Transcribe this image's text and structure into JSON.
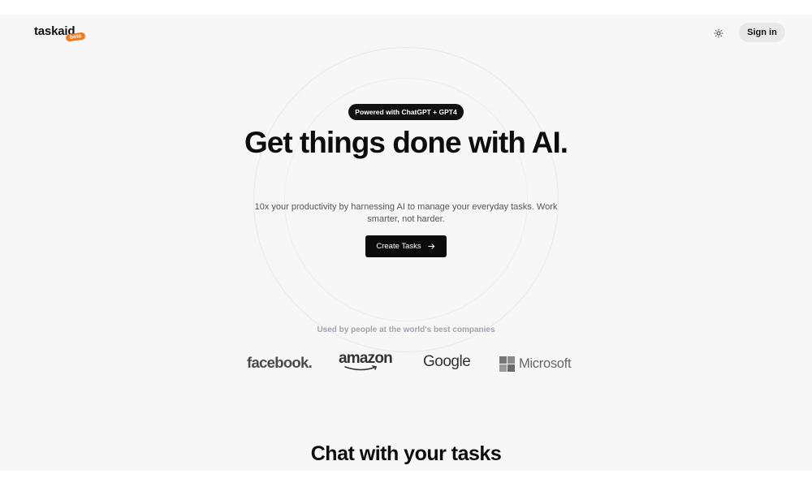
{
  "nav": {
    "logo": "taskaid",
    "beta_badge": "beta",
    "theme_icon": "sun-icon",
    "signin_label": "Sign in"
  },
  "hero": {
    "pill": "Powered with ChatGPT + GPT4",
    "title": "Get things done with AI.",
    "subtitle": "10x your productivity by harnessing AI to manage your everyday tasks. Work smarter, not harder.",
    "cta_label": "Create Tasks",
    "cta_icon": "arrow-right-icon"
  },
  "companies": {
    "caption": "Used by people at the world's best companies",
    "logos": {
      "facebook": "facebook.",
      "amazon": "amazon",
      "google": "Google",
      "microsoft": "Microsoft"
    }
  },
  "section": {
    "title": "Chat with your tasks"
  },
  "colors": {
    "background": "#f7f7f7",
    "accent": "#f27a1a",
    "primary": "#0b0b0b"
  }
}
